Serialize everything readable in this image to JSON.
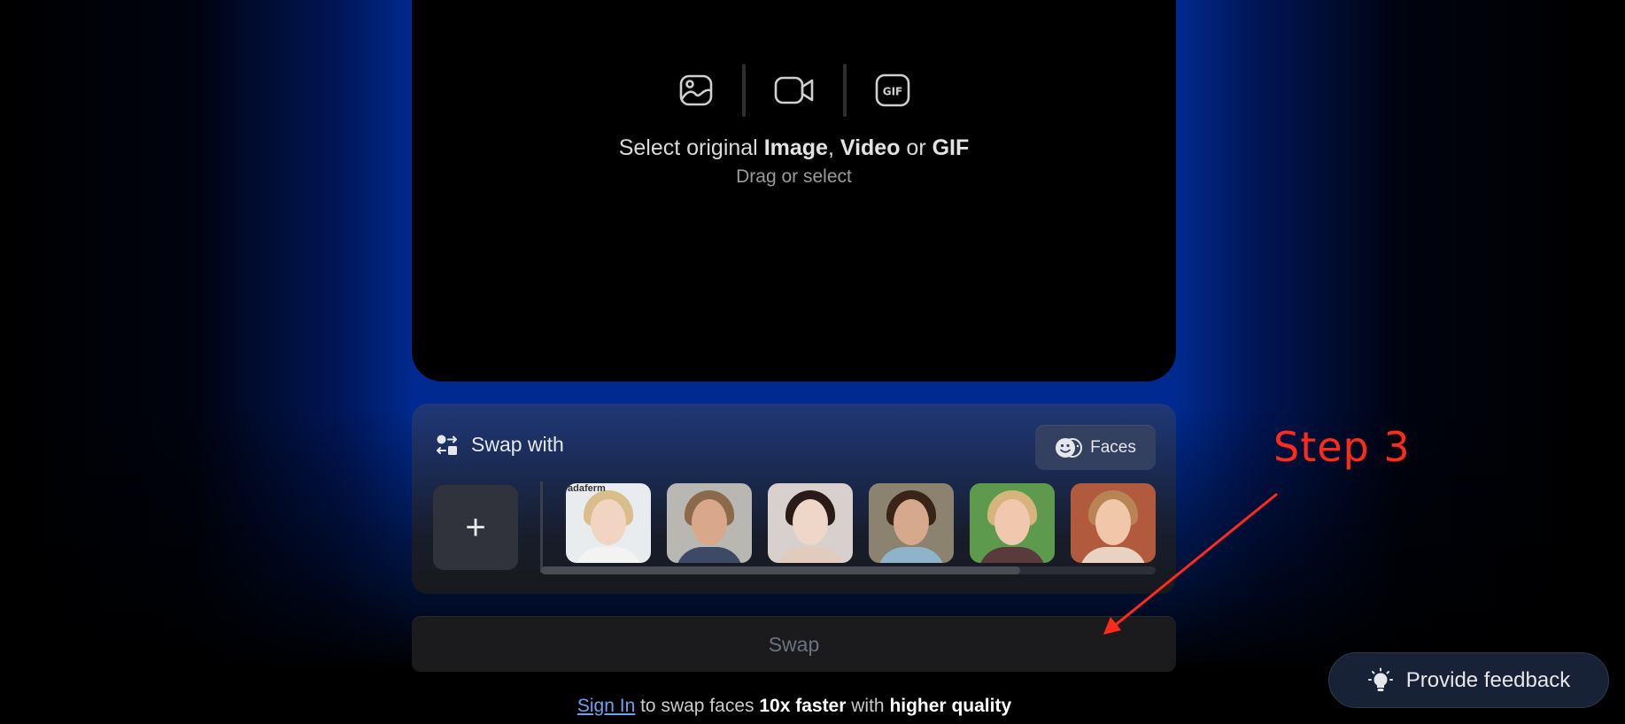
{
  "upload": {
    "media_types": [
      "image",
      "video",
      "gif"
    ],
    "title_prefix": "Select original ",
    "title_image": "Image",
    "title_sep1": ", ",
    "title_video": "Video",
    "title_sep2": " or ",
    "title_gif": "GIF",
    "subtitle": "Drag or select",
    "gif_icon_text": "GIF"
  },
  "swap_with": {
    "label": "Swap with",
    "faces_button": "Faces",
    "add_button": "+",
    "thumbnails": [
      {
        "name": "face-1",
        "bg": "#e9ecef",
        "skin": "#f1d4c2",
        "hair": "#d9bd8b",
        "body": "#f3f3f3",
        "watermark": "adaferm"
      },
      {
        "name": "face-2",
        "bg": "#b9b7b2",
        "skin": "#d9a88a",
        "hair": "#8a6a4a",
        "body": "#3d4a66",
        "watermark": ""
      },
      {
        "name": "face-3",
        "bg": "#d8d0cc",
        "skin": "#eed6c8",
        "hair": "#2a1b18",
        "body": "#e0cbbd",
        "watermark": ""
      },
      {
        "name": "face-4",
        "bg": "#8b8270",
        "skin": "#d6a98c",
        "hair": "#3a2418",
        "body": "#8fb3c9",
        "watermark": ""
      },
      {
        "name": "face-5",
        "bg": "#5e9a4e",
        "skin": "#f0c8ae",
        "hair": "#d6b57d",
        "body": "#5a3b3b",
        "watermark": ""
      },
      {
        "name": "face-6",
        "bg": "#b25a3e",
        "skin": "#f0c7a8",
        "hair": "#b88454",
        "body": "#e8d2c2",
        "watermark": ""
      }
    ],
    "scroll_position": 0.78
  },
  "swap_button": "Swap",
  "signin": {
    "link": "Sign In",
    "text1": " to swap faces ",
    "bold1": "10x faster",
    "text2": " with ",
    "bold2": "higher quality"
  },
  "feedback_button": "Provide feedback",
  "annotation": {
    "label": "Step 3",
    "color": "#ff2a1a"
  }
}
